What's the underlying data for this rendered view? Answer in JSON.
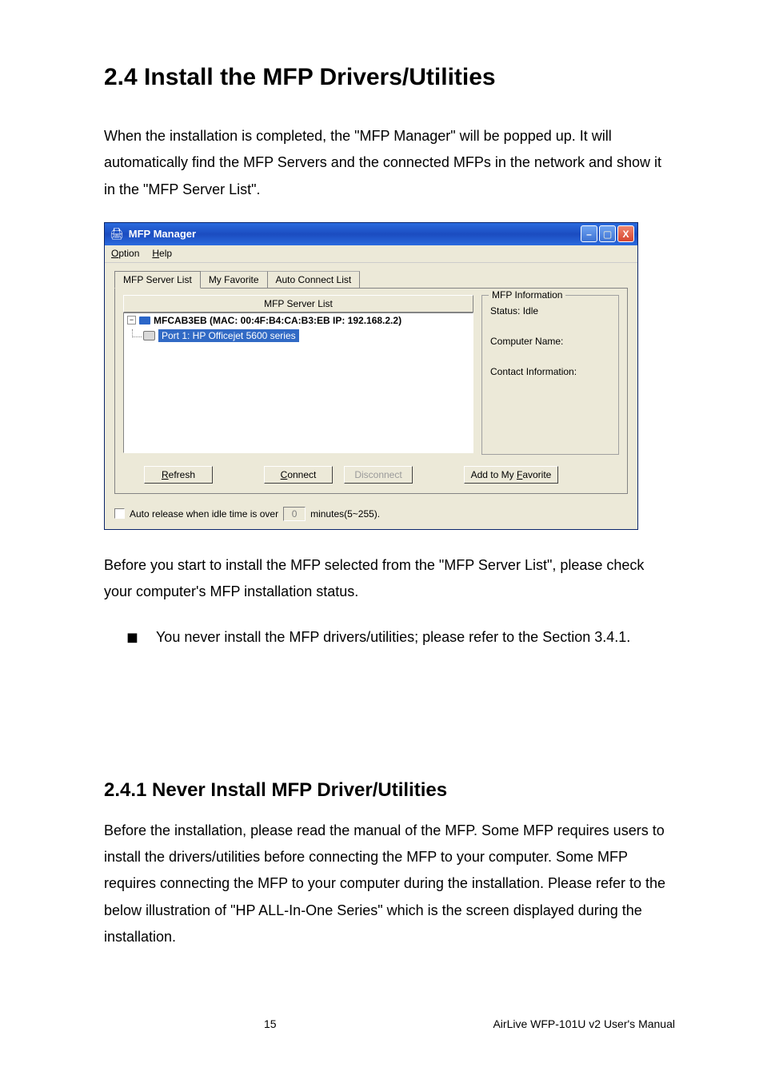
{
  "headings": {
    "h1": "2.4   Install the MFP Drivers/Utilities",
    "h2": "2.4.1   Never Install MFP Driver/Utilities"
  },
  "paras": {
    "p1": "When the installation is completed, the \"MFP Manager\" will be popped up. It will automatically find the MFP Servers and the connected MFPs in the network and show it in the \"MFP Server List\".",
    "p2": "Before you start to install the MFP selected from the \"MFP Server List\", please check your computer's MFP installation status.",
    "bullet": "You never install the MFP drivers/utilities; please refer to the Section 3.4.1.",
    "p3": "Before the installation, please read the manual of the MFP. Some MFP requires users to install the drivers/utilities before connecting the MFP to your computer. Some MFP requires connecting the MFP to your computer during the installation. Please refer to the below illustration of \"HP ALL-In-One Series\" which is the screen displayed during the installation."
  },
  "bullet_mark": "◼",
  "window": {
    "title": "MFP Manager",
    "menu": {
      "option": "Option",
      "help": "Help"
    },
    "tabs": {
      "t1": "MFP Server List",
      "t2": "My Favorite",
      "t3": "Auto Connect List"
    },
    "list_header": "MFP Server List",
    "server_line": "MFCAB3EB (MAC: 00:4F:B4:CA:B3:EB   IP: 192.168.2.2)",
    "port_line": "Port 1: HP Officejet 5600 series",
    "expander": "−",
    "info": {
      "legend": "MFP Information",
      "status": "Status: Idle",
      "computer": "Computer Name:",
      "contact": "Contact Information:"
    },
    "buttons": {
      "refresh": "Refresh",
      "connect": "Connect",
      "disconnect": "Disconnect",
      "add_fav": "Add to My Favorite"
    },
    "footer": {
      "auto_release": "Auto release when idle time is over",
      "value": "0",
      "minutes": "minutes(5~255)."
    },
    "controls": {
      "min": "–",
      "max": "▢",
      "close": "X"
    }
  },
  "page_footer": {
    "num": "15",
    "text": "AirLive WFP-101U v2 User's Manual"
  }
}
